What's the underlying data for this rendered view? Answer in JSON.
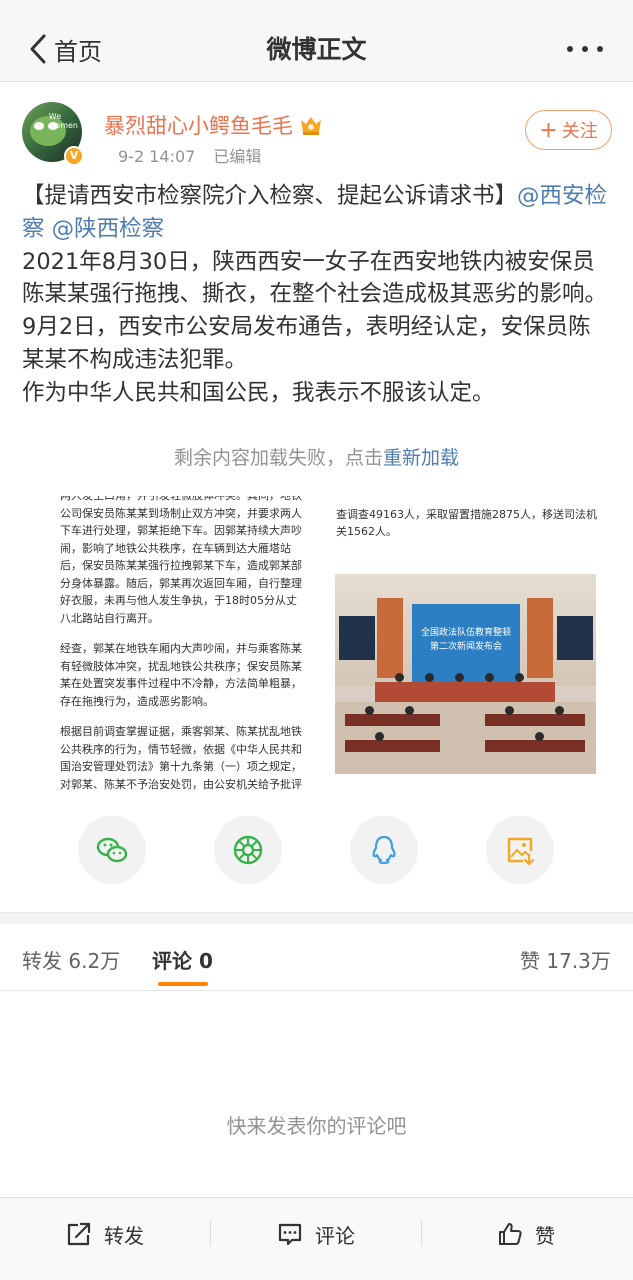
{
  "nav": {
    "back_label": "首页",
    "title": "微博正文"
  },
  "author": {
    "name": "暴烈甜心小鳄鱼毛毛",
    "avatar_text": "We\nwomen",
    "verified_badge": "V",
    "time": "9-2 14:07",
    "edited": "已编辑",
    "follow_label": "关注"
  },
  "post": {
    "title": "【提请西安市检察院介入检察、提起公诉请求书】",
    "mention_1": "@西安检察",
    "mention_2": "@陕西检察",
    "paragraph_1": "2021年8月30日，陕西西安一女子在西安地铁内被安保员陈某某强行拖拽、撕衣，在整个社会造成极其恶劣的影响。9月2日，西安市公安局发布通告，表明经认定，安保员陈某某不构成违法犯罪。",
    "paragraph_2": "作为中华人民共和国公民，我表示不服该认定。",
    "load_fail_text": "剩余内容加载失败，点击",
    "reload_label": "重新加载"
  },
  "image_1": {
    "para_1": "两人发生口角，并引发轻微肢体冲突。其间，地铁公司保安员陈某某到场制止双方冲突，并要求两人下车进行处理，郭某拒绝下车。因郭某持续大声吵闹，影响了地铁公共秩序，在车辆到达大雁塔站后，保安员陈某某强行拉拽郭某下车，造成郭某部分身体暴露。随后，郭某再次返回车厢，自行整理好衣服，未再与他人发生争执，于18时05分从丈八北路站自行离开。",
    "para_2": "经查，郭某在地铁车厢内大声吵闹，并与乘客陈某有轻微肢体冲突，扰乱地铁公共秩序；保安员陈某某在处置突发事件过程中不冷静，方法简单粗暴，存在拖拽行为，造成恶劣影响。",
    "para_3": "根据目前调查掌握证据，乘客郭某、陈某扰乱地铁公共秩序的行为，情节轻微，依据《中华人民共和国治安管理处罚法》第十九条第（一）项之规定，对郭某、陈某不予治安处罚，由公安机关给予批评教育。保安员陈某某不构成违法犯罪，"
  },
  "image_2": {
    "text": "查调查49163人，采取留置措施2875人，移送司法机关1562人。",
    "screen_text": "全国政法队伍教育整顿\n第二次新闻发布会"
  },
  "share": [
    {
      "name": "wechat-share-button",
      "icon": "wechat-icon",
      "color": "#35b34a"
    },
    {
      "name": "moments-share-button",
      "icon": "moments-icon",
      "color": "#35b34a"
    },
    {
      "name": "qq-share-button",
      "icon": "qq-icon",
      "color": "#3d9ee0"
    },
    {
      "name": "save-image-button",
      "icon": "save-image-icon",
      "color": "#f5a623"
    }
  ],
  "tabs": {
    "repost": "转发 6.2万",
    "comment": "评论 0",
    "like": "赞 17.3万"
  },
  "empty_comments": "快来发表你的评论吧",
  "bottom_bar": {
    "repost": "转发",
    "comment": "评论",
    "like": "赞"
  },
  "colors": {
    "accent": "#ff8200",
    "link": "#507daf",
    "name": "#eb7350"
  }
}
